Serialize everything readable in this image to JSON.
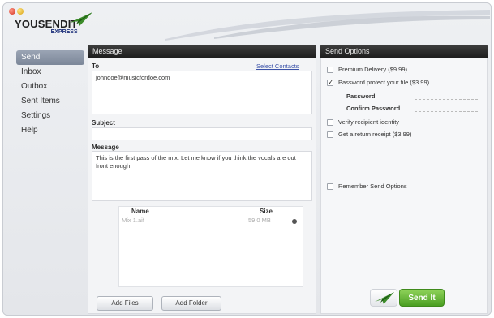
{
  "app": {
    "logo_text": "YOUSENDIT",
    "logo_sub": "EXPRESS"
  },
  "sidebar": {
    "items": [
      {
        "label": "Send",
        "active": true
      },
      {
        "label": "Inbox"
      },
      {
        "label": "Outbox"
      },
      {
        "label": "Sent Items"
      },
      {
        "label": "Settings"
      },
      {
        "label": "Help"
      }
    ]
  },
  "message": {
    "header": "Message",
    "to_label": "To",
    "select_contacts": "Select Contacts",
    "to_value": "johndoe@musicfordoe.com",
    "subject_label": "Subject",
    "subject_value": "",
    "message_label": "Message",
    "message_value": "This is the first pass of the mix. Let me know if you think the vocals are out front enough",
    "files": {
      "col_name": "Name",
      "col_size": "Size",
      "rows": [
        {
          "name": "Mix 1.aif",
          "size": "59.0 MB"
        }
      ]
    },
    "add_files": "Add Files",
    "add_folder": "Add Folder"
  },
  "send_options": {
    "header": "Send Options",
    "premium": "Premium Delivery ($9.99)",
    "password_protect": "Password protect your file ($3.99)",
    "password_label": "Password",
    "confirm_password_label": "Confirm Password",
    "verify": "Verify recipient identity",
    "return_receipt": "Get a return receipt ($3.99)",
    "remember": "Remember Send Options"
  },
  "send_button": "Send It",
  "colors": {
    "accent_green": "#4a9e22",
    "header_dark": "#2a2a2a",
    "link_blue": "#3b52a8"
  }
}
